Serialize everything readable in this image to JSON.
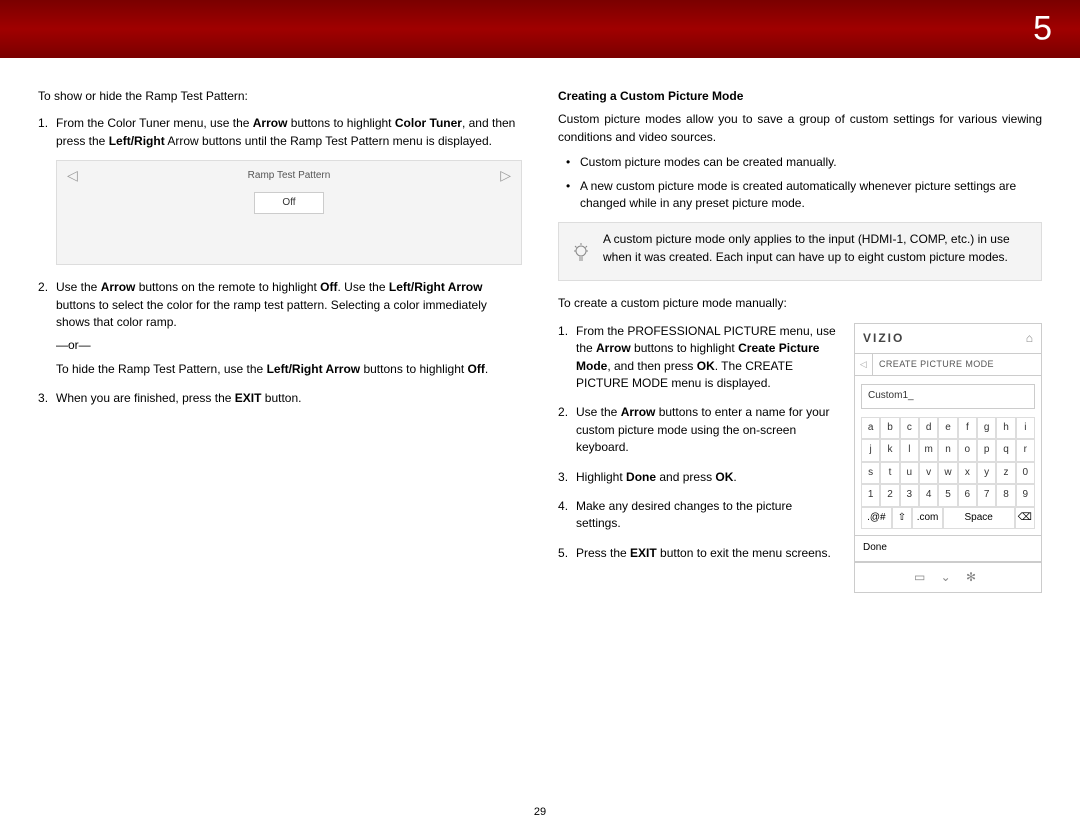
{
  "chapter_number": "5",
  "page_number": "29",
  "left": {
    "intro": "To show or hide the Ramp Test Pattern:",
    "step1_a": "From the Color Tuner menu, use the ",
    "step1_b": " buttons to highlight ",
    "step1_c": ", and then press the ",
    "step1_d": " Arrow buttons until the Ramp Test Pattern menu is displayed.",
    "arrow_word": "Arrow",
    "color_tuner": "Color Tuner",
    "left_right": "Left/Right",
    "ramp_title": "Ramp Test Pattern",
    "off_label": "Off",
    "step2_a": "Use the ",
    "step2_b": " buttons on the remote to highlight ",
    "step2_c": ". Use the ",
    "step2_d": " buttons to select the color for the ramp test pattern. Selecting a color immediately shows that color ramp.",
    "off_bold": "Off",
    "left_right_arrow": "Left/Right Arrow",
    "or_text": "—or—",
    "hide_a": "To hide the Ramp Test Pattern, use the ",
    "hide_b": " buttons to highlight ",
    "hide_c": ".",
    "step3_a": "When you are finished, press the ",
    "step3_b": " button.",
    "exit_word": "EXIT"
  },
  "right": {
    "heading": "Creating a Custom Picture Mode",
    "para1": "Custom picture modes allow you to save a group of custom settings for various viewing conditions and video sources.",
    "bullet1": "Custom picture modes can be created manually.",
    "bullet2": "A new custom picture mode is created automatically whenever picture settings are changed while in any preset picture mode.",
    "hint": "A custom picture mode only applies to the input (HDMI-1, COMP, etc.) in use when it was created. Each input can have up to eight custom picture modes.",
    "create_intro": "To create a custom picture mode manually:",
    "s1_a": "From the PROFESSIONAL PICTURE menu, use the ",
    "s1_b": " buttons to highlight ",
    "s1_c": ", and then press ",
    "s1_d": ". The CREATE PICTURE MODE menu is displayed.",
    "arrow_word": "Arrow",
    "create_bold": "Create Picture Mode",
    "ok_word": "OK",
    "s2_a": "Use the ",
    "s2_b": " buttons to enter a name for your custom picture mode using the on-screen keyboard.",
    "s3_a": "Highlight ",
    "s3_b": " and press ",
    "s3_c": ".",
    "done_word": "Done",
    "s4": "Make any desired changes to the picture settings.",
    "s5_a": "Press the ",
    "s5_b": " button to exit the menu screens.",
    "exit_word": "EXIT"
  },
  "tv": {
    "brand": "VIZIO",
    "menu_title": "CREATE PICTURE MODE",
    "name_value": "Custom1_",
    "keys_r1": [
      "a",
      "b",
      "c",
      "d",
      "e",
      "f",
      "g",
      "h",
      "i"
    ],
    "keys_r2": [
      "j",
      "k",
      "l",
      "m",
      "n",
      "o",
      "p",
      "q",
      "r"
    ],
    "keys_r3": [
      "s",
      "t",
      "u",
      "v",
      "w",
      "x",
      "y",
      "z",
      "0"
    ],
    "keys_r4": [
      "1",
      "2",
      "3",
      "4",
      "5",
      "6",
      "7",
      "8",
      "9"
    ],
    "sym_key": ".@#",
    "shift_key": "⇧",
    "com_key": ".com",
    "space_key": "Space",
    "back_key": "⌫",
    "done": "Done"
  }
}
